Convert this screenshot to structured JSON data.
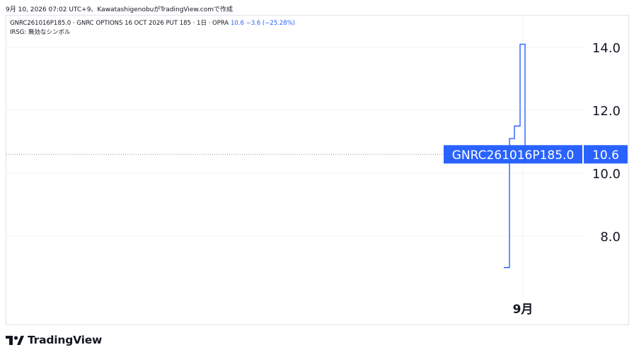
{
  "header": {
    "caption": "9月 10, 2026 07:02 UTC+9、KawatashigenobuがTradingView.comで作成"
  },
  "legend": {
    "line1_label": "GNRC261016P185.0 · GNRC OPTIONS 16 OCT 2026 PUT 185 · 1日 · OPRA",
    "line1_value": "10.6 −3.6 (−25.28%)",
    "line2": "IRSG: 無効なシンボル"
  },
  "brand": {
    "name": "TradingView",
    "icon": "tradingview-logo-icon"
  },
  "colors": {
    "line": "#2962ff",
    "label_bg": "#2962ff",
    "grid": "#f0f3fa",
    "text": "#131722"
  },
  "chart_data": {
    "type": "line",
    "style": "step",
    "series": [
      {
        "values": [
          {
            "x": 0,
            "y": 7.0
          },
          {
            "x": 1,
            "y": 11.1
          },
          {
            "x": 2,
            "y": 11.5
          },
          {
            "x": 3,
            "y": 14.1
          },
          {
            "x": 4,
            "y": 10.6
          }
        ]
      }
    ],
    "x_tick_label": "9月",
    "y_ticks": [
      8.0,
      10.0,
      12.0,
      14.0
    ],
    "y_tick_labels": [
      "8.0",
      "10.0",
      "12.0",
      "14.0"
    ],
    "ylim": [
      6.0,
      15.0
    ],
    "last_value": 10.6,
    "last_value_label": "10.6",
    "symbol_label": "GNRC261016P185.0",
    "grid": true
  }
}
